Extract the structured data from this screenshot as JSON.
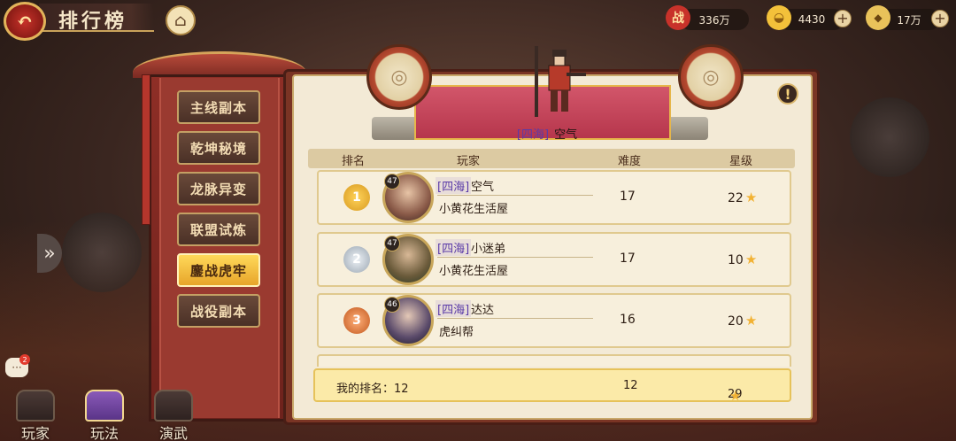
{
  "header": {
    "title": "排行榜",
    "back_icon": "back-icon",
    "home_icon": "home-icon"
  },
  "resources": [
    {
      "icon": "战",
      "value": "336万"
    },
    {
      "icon": "gold-ingot-icon",
      "value": "4430"
    },
    {
      "icon": "coin-icon",
      "value": "17万"
    }
  ],
  "sidebar": {
    "items": [
      {
        "label": "主线副本",
        "active": false
      },
      {
        "label": "乾坤秘境",
        "active": false
      },
      {
        "label": "龙脉异变",
        "active": false
      },
      {
        "label": "联盟试炼",
        "active": false
      },
      {
        "label": "鏖战虎牢",
        "active": true
      },
      {
        "label": "战役副本",
        "active": false
      }
    ]
  },
  "chat": {
    "badge": "2"
  },
  "bottom_nav": [
    {
      "label": "玩家",
      "active": false
    },
    {
      "label": "玩法",
      "active": true
    },
    {
      "label": "演武",
      "active": false
    }
  ],
  "champion": {
    "guild": "[四海]",
    "name": "空气"
  },
  "table": {
    "headers": {
      "rank": "排名",
      "player": "玩家",
      "difficulty": "难度",
      "stars": "星级"
    },
    "rows": [
      {
        "rank": "1",
        "level": "47",
        "guild": "[四海]",
        "name": "空气",
        "club": "小黄花生活屋",
        "difficulty": "17",
        "stars": "22"
      },
      {
        "rank": "2",
        "level": "47",
        "guild": "[四海]",
        "name": "小迷弟",
        "club": "小黄花生活屋",
        "difficulty": "17",
        "stars": "10"
      },
      {
        "rank": "3",
        "level": "46",
        "guild": "[四海]",
        "name": "达达",
        "club": "虎纠帮",
        "difficulty": "16",
        "stars": "20"
      }
    ]
  },
  "my_rank": {
    "label": "我的排名：12",
    "difficulty": "12",
    "stars": "29"
  },
  "colors": {
    "accent_gold": "#e7a52a",
    "guild_purple": "#5a3aa8",
    "star": "#f2b233",
    "panel_red": "#7a3424"
  }
}
